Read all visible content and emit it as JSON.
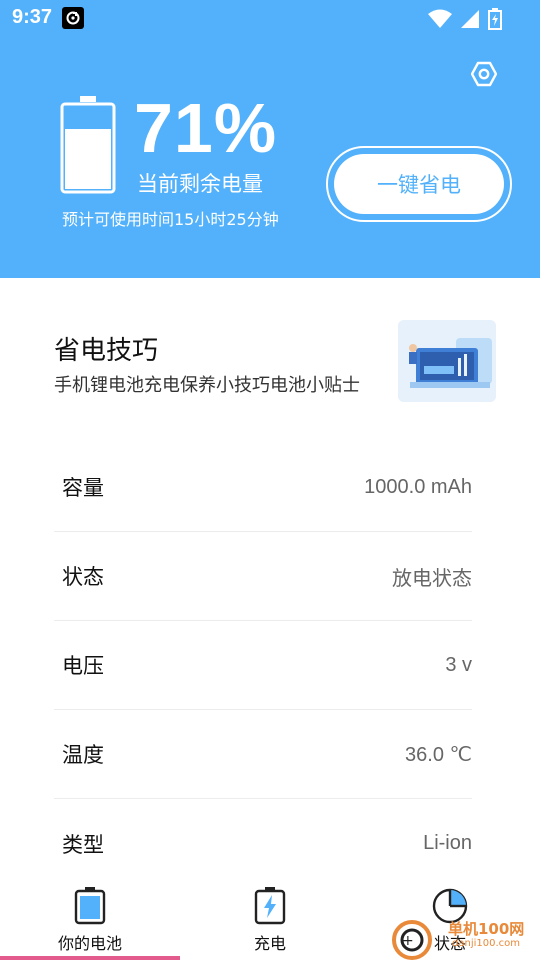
{
  "status_bar": {
    "time": "9:37"
  },
  "battery": {
    "percent_text": "71%",
    "level": 0.71,
    "remaining_label": "当前剩余电量",
    "usage_time": "预计可使用时间15小时25分钟"
  },
  "save_button": {
    "label": "一键省电"
  },
  "tips": {
    "title": "省电技巧",
    "subtitle": "手机锂电池充电保养小技巧电池小贴士"
  },
  "info": [
    {
      "label": "容量",
      "value": "1000.0 mAh"
    },
    {
      "label": "状态",
      "value": "放电状态"
    },
    {
      "label": "电压",
      "value": "3 v"
    },
    {
      "label": "温度",
      "value": "36.0 ℃"
    },
    {
      "label": "类型",
      "value": "Li-ion"
    }
  ],
  "tabs": [
    {
      "label": "你的电池",
      "icon": "battery-icon"
    },
    {
      "label": "充电",
      "icon": "charging-icon"
    },
    {
      "label": "状态",
      "icon": "pie-chart-icon"
    }
  ],
  "watermark": {
    "text": "单机100网",
    "url": "danji100.com"
  },
  "colors": {
    "primary": "#52b1fa",
    "tab_indicator": "#e35a8c"
  }
}
